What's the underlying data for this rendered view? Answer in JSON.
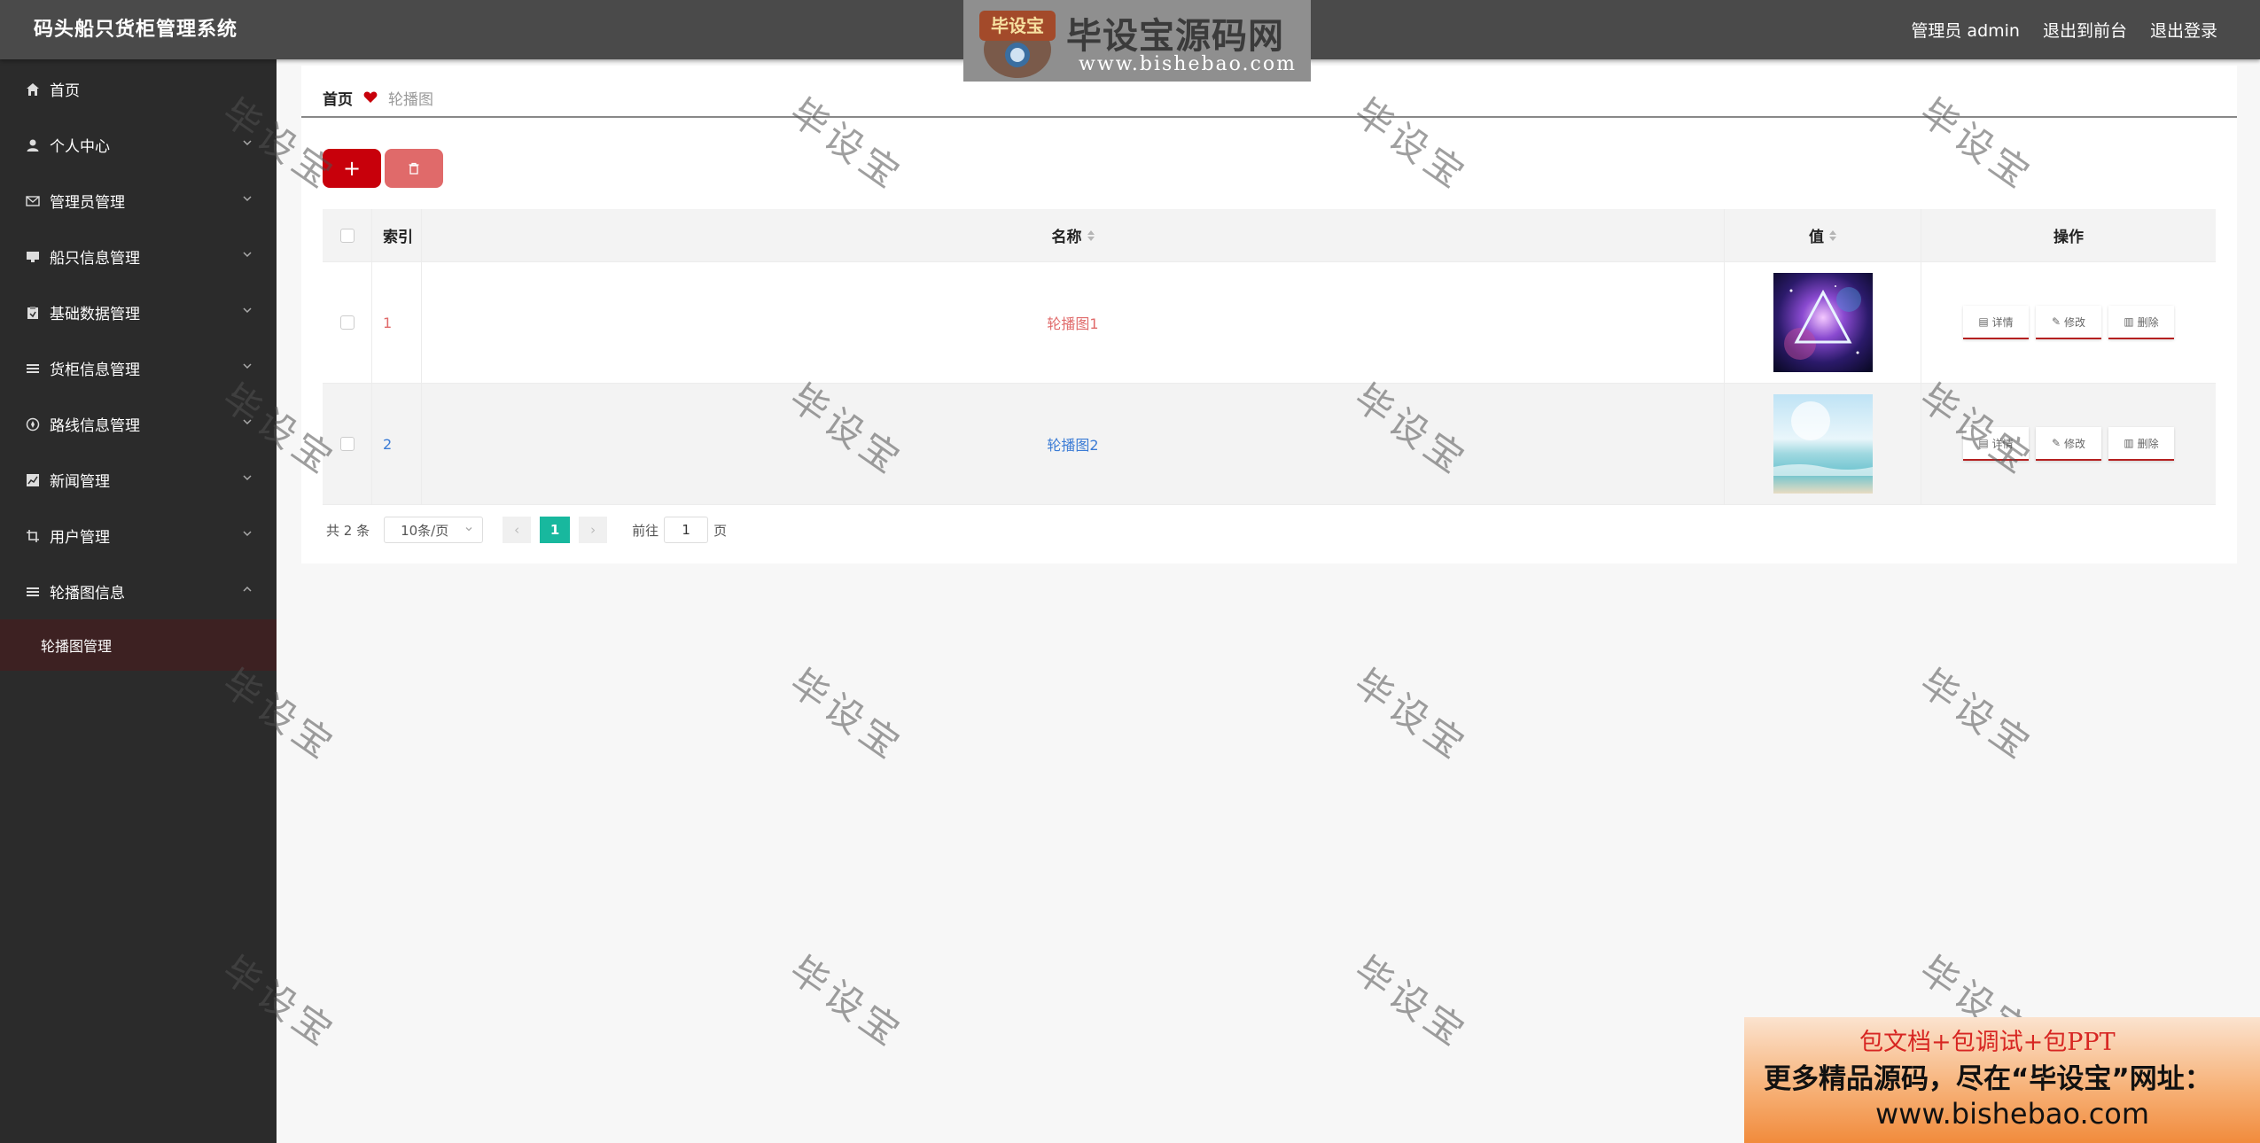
{
  "header": {
    "app_title": "码头船只货柜管理系统",
    "user_label": "管理员 admin",
    "front_link": "退出到前台",
    "logout_link": "退出登录"
  },
  "logo": {
    "badge_text": "毕设宝",
    "name": "毕设宝源码网",
    "url": "www.bishebao.com"
  },
  "sidebar": {
    "items": [
      {
        "label": "首页",
        "icon": "home-icon"
      },
      {
        "label": "个人中心",
        "icon": "user-icon"
      },
      {
        "label": "管理员管理",
        "icon": "mail-icon"
      },
      {
        "label": "船只信息管理",
        "icon": "monitor-icon"
      },
      {
        "label": "基础数据管理",
        "icon": "clipboard-icon"
      },
      {
        "label": "货柜信息管理",
        "icon": "list-icon"
      },
      {
        "label": "路线信息管理",
        "icon": "compass-icon"
      },
      {
        "label": "新闻管理",
        "icon": "chart-icon"
      },
      {
        "label": "用户管理",
        "icon": "crop-icon"
      },
      {
        "label": "轮播图信息",
        "icon": "list-icon"
      }
    ],
    "sub_item": "轮播图管理"
  },
  "breadcrumb": {
    "home": "首页",
    "current": "轮播图"
  },
  "toolbar": {
    "add_label": "+"
  },
  "table": {
    "headers": {
      "index": "索引",
      "name": "名称",
      "value": "值",
      "ops": "操作"
    },
    "rows": [
      {
        "index": "1",
        "name": "轮播图1"
      },
      {
        "index": "2",
        "name": "轮播图2"
      }
    ],
    "ops": {
      "detail": "详情",
      "edit": "修改",
      "delete": "删除"
    }
  },
  "pagination": {
    "total": "共 2 条",
    "page_size": "10条/页",
    "current_page": "1",
    "goto_prefix": "前往",
    "goto_value": "1",
    "goto_suffix": "页"
  },
  "watermark": "毕设宝",
  "ad": {
    "line1": "包文档+包调试+包PPT",
    "line2": "更多精品源码，尽在“毕设宝”网址：",
    "line3": "www.bishebao.com"
  },
  "colors": {
    "header_bg": "#4a4a4a",
    "sidebar_bg": "#2b2b2b",
    "accent_red": "#c8000b",
    "pager_active": "#18b89e"
  }
}
